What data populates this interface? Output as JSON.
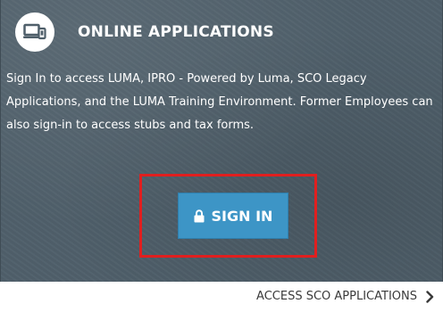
{
  "header": {
    "icon": "device-screens-icon",
    "title": "ONLINE APPLICATIONS"
  },
  "description": "Sign In to access LUMA, IPRO - Powered by Luma, SCO Legacy Applications, and the LUMA Training Environment. Former Employees can also sign-in to access stubs and tax forms.",
  "signin": {
    "label": "SIGN IN",
    "icon": "lock-icon",
    "button_color": "#3d95c6"
  },
  "highlight_color": "#e01f1f",
  "footer": {
    "link_label": "ACCESS SCO APPLICATIONS",
    "icon": "chevron-right-icon"
  }
}
